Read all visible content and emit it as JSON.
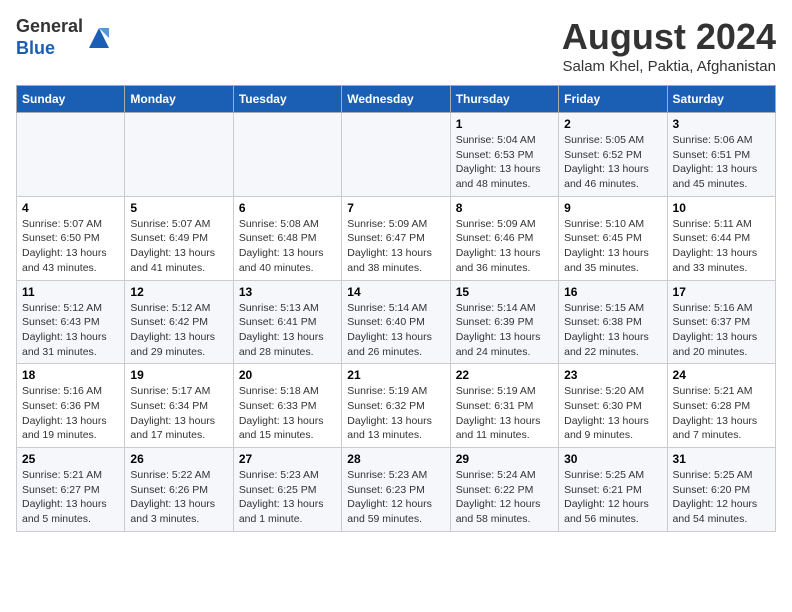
{
  "header": {
    "logo_line1": "General",
    "logo_line2": "Blue",
    "title": "August 2024",
    "subtitle": "Salam Khel, Paktia, Afghanistan"
  },
  "weekdays": [
    "Sunday",
    "Monday",
    "Tuesday",
    "Wednesday",
    "Thursday",
    "Friday",
    "Saturday"
  ],
  "weeks": [
    [
      {
        "day": "",
        "sunrise": "",
        "sunset": "",
        "daylight": ""
      },
      {
        "day": "",
        "sunrise": "",
        "sunset": "",
        "daylight": ""
      },
      {
        "day": "",
        "sunrise": "",
        "sunset": "",
        "daylight": ""
      },
      {
        "day": "",
        "sunrise": "",
        "sunset": "",
        "daylight": ""
      },
      {
        "day": "1",
        "sunrise": "Sunrise: 5:04 AM",
        "sunset": "Sunset: 6:53 PM",
        "daylight": "Daylight: 13 hours and 48 minutes."
      },
      {
        "day": "2",
        "sunrise": "Sunrise: 5:05 AM",
        "sunset": "Sunset: 6:52 PM",
        "daylight": "Daylight: 13 hours and 46 minutes."
      },
      {
        "day": "3",
        "sunrise": "Sunrise: 5:06 AM",
        "sunset": "Sunset: 6:51 PM",
        "daylight": "Daylight: 13 hours and 45 minutes."
      }
    ],
    [
      {
        "day": "4",
        "sunrise": "Sunrise: 5:07 AM",
        "sunset": "Sunset: 6:50 PM",
        "daylight": "Daylight: 13 hours and 43 minutes."
      },
      {
        "day": "5",
        "sunrise": "Sunrise: 5:07 AM",
        "sunset": "Sunset: 6:49 PM",
        "daylight": "Daylight: 13 hours and 41 minutes."
      },
      {
        "day": "6",
        "sunrise": "Sunrise: 5:08 AM",
        "sunset": "Sunset: 6:48 PM",
        "daylight": "Daylight: 13 hours and 40 minutes."
      },
      {
        "day": "7",
        "sunrise": "Sunrise: 5:09 AM",
        "sunset": "Sunset: 6:47 PM",
        "daylight": "Daylight: 13 hours and 38 minutes."
      },
      {
        "day": "8",
        "sunrise": "Sunrise: 5:09 AM",
        "sunset": "Sunset: 6:46 PM",
        "daylight": "Daylight: 13 hours and 36 minutes."
      },
      {
        "day": "9",
        "sunrise": "Sunrise: 5:10 AM",
        "sunset": "Sunset: 6:45 PM",
        "daylight": "Daylight: 13 hours and 35 minutes."
      },
      {
        "day": "10",
        "sunrise": "Sunrise: 5:11 AM",
        "sunset": "Sunset: 6:44 PM",
        "daylight": "Daylight: 13 hours and 33 minutes."
      }
    ],
    [
      {
        "day": "11",
        "sunrise": "Sunrise: 5:12 AM",
        "sunset": "Sunset: 6:43 PM",
        "daylight": "Daylight: 13 hours and 31 minutes."
      },
      {
        "day": "12",
        "sunrise": "Sunrise: 5:12 AM",
        "sunset": "Sunset: 6:42 PM",
        "daylight": "Daylight: 13 hours and 29 minutes."
      },
      {
        "day": "13",
        "sunrise": "Sunrise: 5:13 AM",
        "sunset": "Sunset: 6:41 PM",
        "daylight": "Daylight: 13 hours and 28 minutes."
      },
      {
        "day": "14",
        "sunrise": "Sunrise: 5:14 AM",
        "sunset": "Sunset: 6:40 PM",
        "daylight": "Daylight: 13 hours and 26 minutes."
      },
      {
        "day": "15",
        "sunrise": "Sunrise: 5:14 AM",
        "sunset": "Sunset: 6:39 PM",
        "daylight": "Daylight: 13 hours and 24 minutes."
      },
      {
        "day": "16",
        "sunrise": "Sunrise: 5:15 AM",
        "sunset": "Sunset: 6:38 PM",
        "daylight": "Daylight: 13 hours and 22 minutes."
      },
      {
        "day": "17",
        "sunrise": "Sunrise: 5:16 AM",
        "sunset": "Sunset: 6:37 PM",
        "daylight": "Daylight: 13 hours and 20 minutes."
      }
    ],
    [
      {
        "day": "18",
        "sunrise": "Sunrise: 5:16 AM",
        "sunset": "Sunset: 6:36 PM",
        "daylight": "Daylight: 13 hours and 19 minutes."
      },
      {
        "day": "19",
        "sunrise": "Sunrise: 5:17 AM",
        "sunset": "Sunset: 6:34 PM",
        "daylight": "Daylight: 13 hours and 17 minutes."
      },
      {
        "day": "20",
        "sunrise": "Sunrise: 5:18 AM",
        "sunset": "Sunset: 6:33 PM",
        "daylight": "Daylight: 13 hours and 15 minutes."
      },
      {
        "day": "21",
        "sunrise": "Sunrise: 5:19 AM",
        "sunset": "Sunset: 6:32 PM",
        "daylight": "Daylight: 13 hours and 13 minutes."
      },
      {
        "day": "22",
        "sunrise": "Sunrise: 5:19 AM",
        "sunset": "Sunset: 6:31 PM",
        "daylight": "Daylight: 13 hours and 11 minutes."
      },
      {
        "day": "23",
        "sunrise": "Sunrise: 5:20 AM",
        "sunset": "Sunset: 6:30 PM",
        "daylight": "Daylight: 13 hours and 9 minutes."
      },
      {
        "day": "24",
        "sunrise": "Sunrise: 5:21 AM",
        "sunset": "Sunset: 6:28 PM",
        "daylight": "Daylight: 13 hours and 7 minutes."
      }
    ],
    [
      {
        "day": "25",
        "sunrise": "Sunrise: 5:21 AM",
        "sunset": "Sunset: 6:27 PM",
        "daylight": "Daylight: 13 hours and 5 minutes."
      },
      {
        "day": "26",
        "sunrise": "Sunrise: 5:22 AM",
        "sunset": "Sunset: 6:26 PM",
        "daylight": "Daylight: 13 hours and 3 minutes."
      },
      {
        "day": "27",
        "sunrise": "Sunrise: 5:23 AM",
        "sunset": "Sunset: 6:25 PM",
        "daylight": "Daylight: 13 hours and 1 minute."
      },
      {
        "day": "28",
        "sunrise": "Sunrise: 5:23 AM",
        "sunset": "Sunset: 6:23 PM",
        "daylight": "Daylight: 12 hours and 59 minutes."
      },
      {
        "day": "29",
        "sunrise": "Sunrise: 5:24 AM",
        "sunset": "Sunset: 6:22 PM",
        "daylight": "Daylight: 12 hours and 58 minutes."
      },
      {
        "day": "30",
        "sunrise": "Sunrise: 5:25 AM",
        "sunset": "Sunset: 6:21 PM",
        "daylight": "Daylight: 12 hours and 56 minutes."
      },
      {
        "day": "31",
        "sunrise": "Sunrise: 5:25 AM",
        "sunset": "Sunset: 6:20 PM",
        "daylight": "Daylight: 12 hours and 54 minutes."
      }
    ]
  ]
}
